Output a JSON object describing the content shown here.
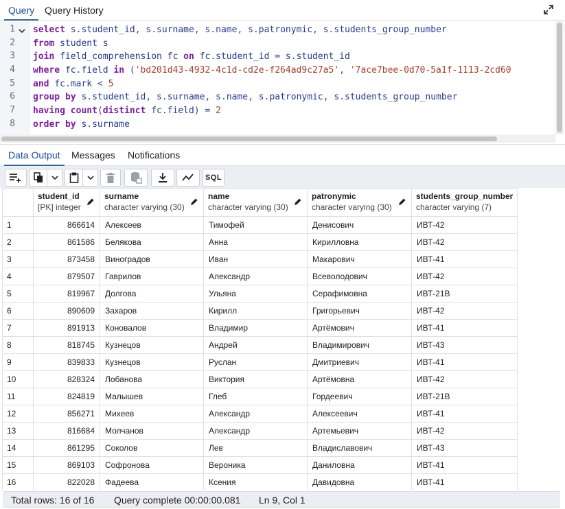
{
  "query_tabs": [
    {
      "label": "Query",
      "active": true
    },
    {
      "label": "Query History",
      "active": false
    }
  ],
  "editor": {
    "line_numbers": [
      "1",
      "2",
      "3",
      "4",
      "5",
      "6",
      "7",
      "8"
    ],
    "lines": [
      "select s.student_id, s.surname, s.name, s.patronymic, s.students_group_number",
      "from student s",
      "join field_comprehension fc on fc.student_id = s.student_id",
      "where fc.field in ('bd201d43-4932-4c1d-cd2e-f264ad9c27a5', '7ace7bee-0d70-5a1f-1113-2cd60",
      "and fc.mark < 5",
      "group by s.student_id, s.surname, s.name, s.patronymic, s.students_group_number",
      "having count(distinct fc.field) = 2",
      "order by s.surname"
    ]
  },
  "output_tabs": [
    {
      "label": "Data Output",
      "active": true
    },
    {
      "label": "Messages",
      "active": false
    },
    {
      "label": "Notifications",
      "active": false
    }
  ],
  "toolbar": {
    "sql_label": "SQL",
    "icons": [
      "add-row-icon",
      "copy-icon",
      "chevron-down-icon",
      "paste-icon",
      "chevron-down-icon",
      "delete-icon",
      "save-data-icon",
      "download-icon",
      "graph-icon",
      "sql-icon"
    ]
  },
  "grid": {
    "columns": [
      {
        "name": "student_id",
        "type": "[PK] integer"
      },
      {
        "name": "surname",
        "type": "character varying (30)"
      },
      {
        "name": "name",
        "type": "character varying (30)"
      },
      {
        "name": "patronymic",
        "type": "character varying (30)"
      },
      {
        "name": "students_group_number",
        "type": "character varying (7)"
      }
    ],
    "rows": [
      [
        "1",
        "866614",
        "Алексеев",
        "Тимофей",
        "Денисович",
        "ИВТ-42"
      ],
      [
        "2",
        "861586",
        "Белякова",
        "Анна",
        "Кирилловна",
        "ИВТ-42"
      ],
      [
        "3",
        "873458",
        "Виноградов",
        "Иван",
        "Макарович",
        "ИВТ-41"
      ],
      [
        "4",
        "879507",
        "Гаврилов",
        "Александр",
        "Всеволодович",
        "ИВТ-42"
      ],
      [
        "5",
        "819967",
        "Долгова",
        "Ульяна",
        "Серафимовна",
        "ИВТ-21В"
      ],
      [
        "6",
        "890609",
        "Захаров",
        "Кирилл",
        "Григорьевич",
        "ИВТ-42"
      ],
      [
        "7",
        "891913",
        "Коновалов",
        "Владимир",
        "Артёмович",
        "ИВТ-41"
      ],
      [
        "8",
        "818745",
        "Кузнецов",
        "Андрей",
        "Владимирович",
        "ИВТ-43"
      ],
      [
        "9",
        "839833",
        "Кузнецов",
        "Руслан",
        "Дмитриевич",
        "ИВТ-41"
      ],
      [
        "10",
        "828324",
        "Лобанова",
        "Виктория",
        "Артёмовна",
        "ИВТ-42"
      ],
      [
        "11",
        "824819",
        "Малышев",
        "Глеб",
        "Гордеевич",
        "ИВТ-21В"
      ],
      [
        "12",
        "856271",
        "Михеев",
        "Александр",
        "Алексеевич",
        "ИВТ-41"
      ],
      [
        "13",
        "816684",
        "Молчанов",
        "Александр",
        "Артемьевич",
        "ИВТ-42"
      ],
      [
        "14",
        "861295",
        "Соколов",
        "Лев",
        "Владиславович",
        "ИВТ-43"
      ],
      [
        "15",
        "869103",
        "Софронова",
        "Вероника",
        "Даниловна",
        "ИВТ-41"
      ],
      [
        "16",
        "822028",
        "Фадеева",
        "Ксения",
        "Давидовна",
        "ИВТ-41"
      ]
    ]
  },
  "status": {
    "total_rows": "Total rows: 16 of 16",
    "query_complete": "Query complete 00:00:00.081",
    "cursor": "Ln 9, Col 1"
  }
}
